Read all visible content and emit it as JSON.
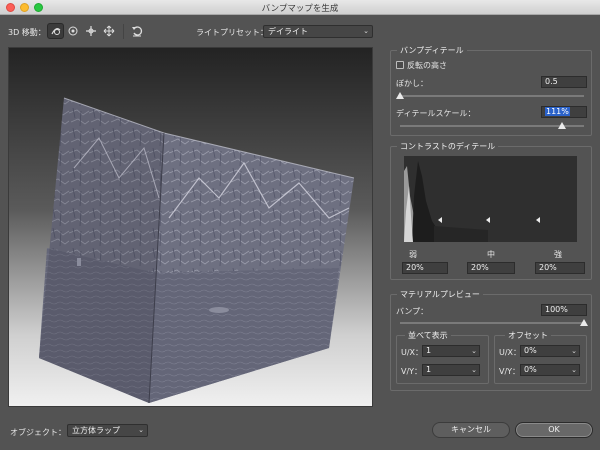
{
  "window": {
    "title": "バンプマップを生成"
  },
  "toolbar": {
    "label": "3D 移動：",
    "tools": [
      "orbit-icon",
      "rotate-icon",
      "pan-icon",
      "slide-icon"
    ],
    "reset": "reset-icon",
    "preset_label": "ライトプリセット：",
    "preset_value": "デイライト"
  },
  "bump_detail": {
    "title": "バンプディテール",
    "invert_label": "反転の高さ",
    "invert_checked": false,
    "blur_label": "ぼかし：",
    "blur_value": "0.5",
    "blur_fraction": 0.0,
    "detail_scale_label": "ディテールスケール：",
    "detail_scale_value": "111%",
    "detail_scale_fraction": 0.88
  },
  "contrast": {
    "title": "コントラストのディテール",
    "weak_label": "弱",
    "mid_label": "中",
    "strong_label": "強",
    "weak_value": "20%",
    "mid_value": "20%",
    "strong_value": "20%"
  },
  "material_preview": {
    "title": "マテリアルプレビュー",
    "bump_label": "バンプ：",
    "bump_value": "100%",
    "bump_fraction": 1.0,
    "tile": {
      "title": "並べて表示",
      "ux_label": "U/X：",
      "ux_value": "1",
      "vy_label": "V/Y：",
      "vy_value": "1"
    },
    "offset": {
      "title": "オフセット",
      "ux_label": "U/X：",
      "ux_value": "0%",
      "vy_label": "V/Y：",
      "vy_value": "0%"
    }
  },
  "object": {
    "label": "オブジェクト：",
    "value": "立方体ラップ"
  },
  "buttons": {
    "cancel": "キャンセル",
    "ok": "OK"
  }
}
